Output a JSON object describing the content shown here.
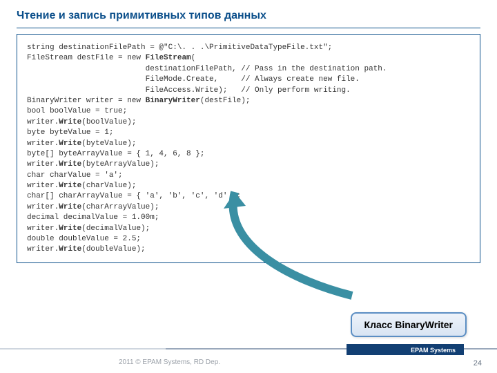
{
  "title": "Чтение и запись примитивных типов данных",
  "code": [
    {
      "pre": "string destinationFilePath = @\"C:\\. . .\\PrimitiveDataTypeFile.txt\";"
    },
    {
      "pre": "FileStream destFile = new ",
      "bold": "FileStream",
      "post": "("
    },
    {
      "pre": "                          destinationFilePath, // Pass in the destination path."
    },
    {
      "pre": "                          FileMode.Create,     // Always create new file."
    },
    {
      "pre": "                          FileAccess.Write);   // Only perform writing."
    },
    {
      "pre": "BinaryWriter writer = new ",
      "bold": "BinaryWriter",
      "post": "(destFile);"
    },
    {
      "pre": "bool boolValue = true;"
    },
    {
      "pre": "writer.",
      "bold": "Write",
      "post": "(boolValue);"
    },
    {
      "pre": "byte byteValue = 1;"
    },
    {
      "pre": "writer.",
      "bold": "Write",
      "post": "(byteValue);"
    },
    {
      "pre": "byte[] byteArrayValue = { 1, 4, 6, 8 };"
    },
    {
      "pre": "writer.",
      "bold": "Write",
      "post": "(byteArrayValue);"
    },
    {
      "pre": "char charValue = 'a';"
    },
    {
      "pre": "writer.",
      "bold": "Write",
      "post": "(charValue);"
    },
    {
      "pre": "char[] charArrayValue = { 'a', 'b', 'c', 'd' };"
    },
    {
      "pre": "writer.",
      "bold": "Write",
      "post": "(charArrayValue);"
    },
    {
      "pre": "decimal decimalValue = 1.00m;"
    },
    {
      "pre": "writer.",
      "bold": "Write",
      "post": "(decimalValue);"
    },
    {
      "pre": "double doubleValue = 2.5;"
    },
    {
      "pre": "writer.",
      "bold": "Write",
      "post": "(doubleValue);"
    }
  ],
  "callout": "Класс BinaryWriter",
  "footer": {
    "copyright": "2011 © EPAM Systems, RD Dep.",
    "brand": "EPAM Systems",
    "page": "24"
  }
}
